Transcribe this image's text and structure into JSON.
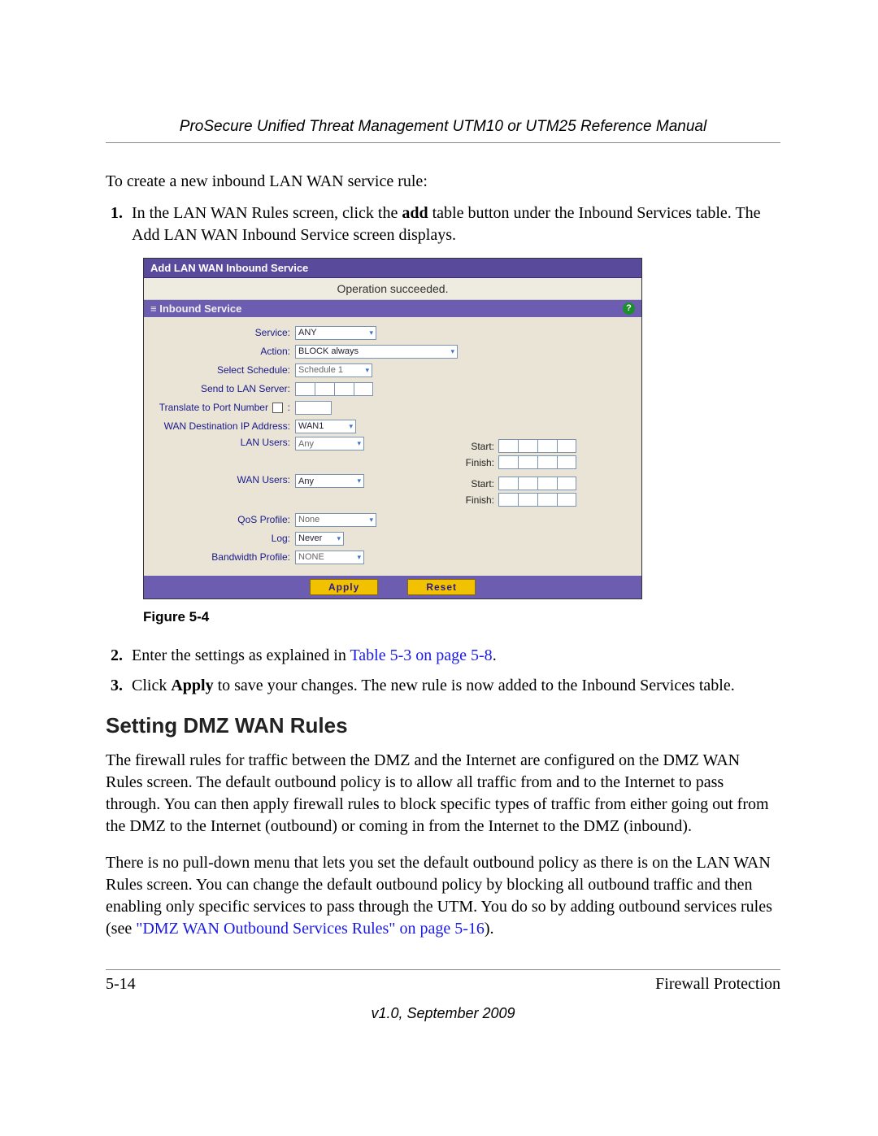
{
  "header": "ProSecure Unified Threat Management UTM10 or UTM25 Reference Manual",
  "intro": "To create a new inbound LAN WAN service rule:",
  "step1": {
    "pre": "In the LAN WAN Rules screen, click the ",
    "bold": "add",
    "post": " table button under the Inbound Services table. The Add LAN WAN Inbound Service screen displays."
  },
  "step2": {
    "pre": "Enter the settings as explained in ",
    "link": "Table 5-3 on page 5-8",
    "post": "."
  },
  "step3": {
    "pre": "Click ",
    "bold": "Apply",
    "post": " to save your changes. The new rule is now added to the Inbound Services table."
  },
  "figure_caption": "Figure 5-4",
  "section_title": "Setting DMZ WAN Rules",
  "para1": "The firewall rules for traffic between the DMZ and the Internet are configured on the DMZ WAN Rules screen. The default outbound policy is to allow all traffic from and to the Internet to pass through. You can then apply firewall rules to block specific types of traffic from either going out from the DMZ to the Internet (outbound) or coming in from the Internet to the DMZ (inbound).",
  "para2_pre": "There is no pull-down menu that lets you set the default outbound policy as there is on the LAN WAN Rules screen. You can change the default outbound policy by blocking all outbound traffic and then enabling only specific services to pass through the UTM. You do so by adding outbound services rules (see ",
  "para2_link": "\"DMZ WAN Outbound Services Rules\" on page 5-16",
  "para2_post": ").",
  "footer_left": "5-14",
  "footer_right": "Firewall Protection",
  "version": "v1.0, September 2009",
  "ui": {
    "titlebar": "Add LAN WAN Inbound Service",
    "status": "Operation succeeded.",
    "section": "Inbound Service",
    "help": "?",
    "labels": {
      "service": "Service:",
      "action": "Action:",
      "schedule": "Select Schedule:",
      "sendlan": "Send to LAN Server:",
      "translate": "Translate to Port Number",
      "wandest": "WAN Destination IP Address:",
      "lanusers": "LAN Users:",
      "wanusers": "WAN Users:",
      "qos": "QoS Profile:",
      "log": "Log:",
      "bw": "Bandwidth Profile:",
      "start": "Start:",
      "finish": "Finish:"
    },
    "values": {
      "service": "ANY",
      "action": "BLOCK always",
      "schedule": "Schedule 1",
      "wandest": "WAN1",
      "lanusers": "Any",
      "wanusers": "Any",
      "qos": "None",
      "log": "Never",
      "bw": "NONE"
    },
    "buttons": {
      "apply": "Apply",
      "reset": "Reset"
    }
  }
}
